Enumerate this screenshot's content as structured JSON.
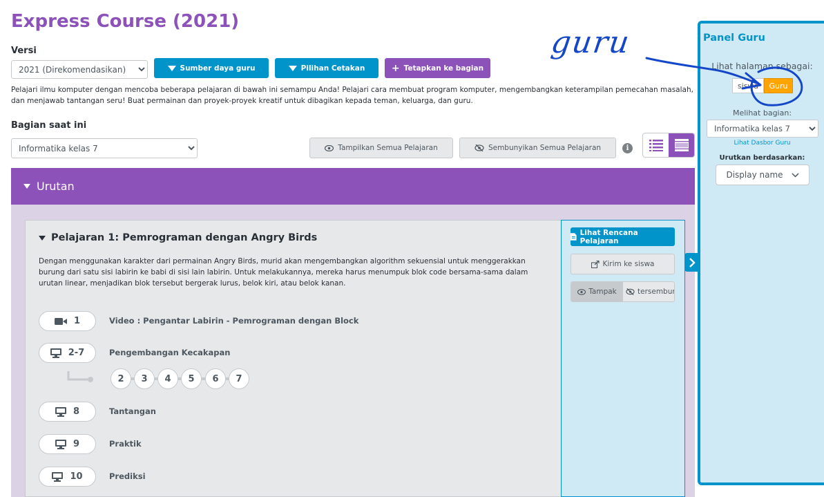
{
  "page_title": "Express Course (2021)",
  "version": {
    "label": "Versi",
    "selected": "2021 (Direkomendasikan)"
  },
  "toolbar": {
    "resources_label": "Sumber daya guru",
    "print_label": "Pilihan Cetakan",
    "assign_label": "Tetapkan ke bagian"
  },
  "description": "Pelajari ilmu komputer dengan mencoba beberapa pelajaran di bawah ini semampu Anda! Pelajari cara membuat program komputer, mengembangkan keterampilan pemecahan masalah, dan menjawab tantangan seru! Buat permainan dan proyek-proyek kreatif untuk dibagikan kepada teman, keluarga, dan guru.",
  "section": {
    "label": "Bagian saat ini",
    "selected": "Informatika kelas 7"
  },
  "visibility": {
    "show_all": "Tampilkan Semua Pelajaran",
    "hide_all": "Sembunyikan Semua Pelajaran"
  },
  "unit": {
    "title": "Urutan"
  },
  "lesson": {
    "title": "Pelajaran 1: Pemrograman dengan Angry Birds",
    "description": "Dengan menggunakan karakter dari permainan Angry Birds, murid akan mengembangkan algorithm sekuensial untuk menggerakkan burung dari satu sisi labirin ke babi di sisi lain labirin. Untuk melakukannya, mereka harus menumpuk blok code bersama-sama dalam urutan linear, menjadikan blok tersebut bergerak lurus, belok kiri, atau belok kanan.",
    "levels": [
      {
        "icon": "video-icon",
        "number": "1",
        "name": "Video : Pengantar Labirin - Pemrograman dengan Block"
      },
      {
        "icon": "computer-icon",
        "number": "2-7",
        "name": "Pengembangan Kecakapan"
      },
      {
        "icon": "computer-icon",
        "number": "8",
        "name": "Tantangan"
      },
      {
        "icon": "computer-icon",
        "number": "9",
        "name": "Praktik"
      },
      {
        "icon": "computer-icon",
        "number": "10",
        "name": "Prediksi"
      }
    ],
    "sub_levels": [
      "2",
      "3",
      "4",
      "5",
      "6",
      "7"
    ]
  },
  "teacher_actions": {
    "lesson_plan": "Lihat Rencana Pelajaran",
    "send_to_students": "Kirim ke siswa",
    "visible": "Tampak",
    "hidden": "tersembunyi"
  },
  "teacher_panel": {
    "title": "Panel Guru",
    "view_as_label": "Lihat halaman sebagai:",
    "student_option": "siswa",
    "teacher_option": "Guru",
    "viewing_section_label": "Melihat bagian:",
    "viewing_section": "Informatika kelas 7",
    "dashboard_link": "Lihat Dasbor Guru",
    "sort_label": "Urutkan berdasarkan:",
    "sort_value": "Display name"
  },
  "annotation": {
    "handwritten": "guru"
  },
  "colors": {
    "purple": "#8c52ba",
    "blue": "#0094ca",
    "orange": "#ffa400",
    "annotation_ink": "#1446c8"
  }
}
